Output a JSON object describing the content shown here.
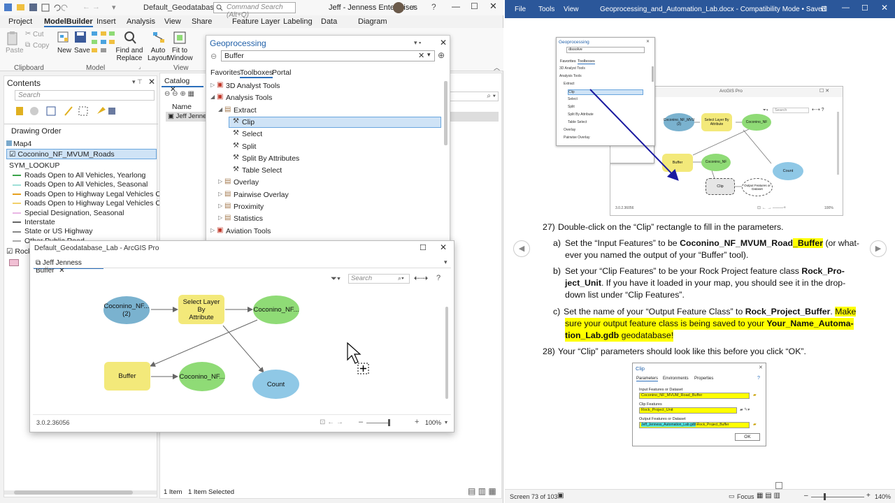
{
  "arcgis": {
    "window_title": "Default_Geodatabase_Lab",
    "command_search_placeholder": "Command Search (Alt+Q)",
    "org": "Jeff - Jenness Enterprises",
    "tabs": [
      "Project",
      "ModelBuilder",
      "Insert",
      "Analysis",
      "View",
      "Share",
      "Feature Layer",
      "Labeling",
      "Data",
      "Diagram"
    ],
    "ribbon": {
      "paste": "Paste",
      "cut": "Cut",
      "copy": "Copy",
      "clipboard_group": "Clipboard",
      "new": "New",
      "save": "Save",
      "model_group": "Model",
      "find_replace": "Find and Replace",
      "auto_layout": "Auto Layout",
      "fit_to_window": "Fit to Window",
      "view_group": "View"
    },
    "contents": {
      "title": "Contents",
      "search_placeholder": "Search",
      "drawing_order": "Drawing Order",
      "map": "Map4",
      "layer": "Coconino_NF_MVUM_Roads",
      "sym_lookup": "SYM_LOOKUP",
      "legend": [
        {
          "label": "Roads Open to All Vehicles, Yearlong",
          "color": "#3aa34a"
        },
        {
          "label": "Roads Open to All Vehicles, Seasonal",
          "color": "#9fe0d8"
        },
        {
          "label": "Roads Open to Highway Legal Vehicles Only, Yearlong",
          "color": "#e6a020"
        },
        {
          "label": "Roads Open to Highway Legal Vehicles Only, Seasonal",
          "color": "#f2d06a"
        },
        {
          "label": "Special Designation, Seasonal",
          "color": "#e9b6e4"
        },
        {
          "label": "Interstate",
          "color": "#666666"
        },
        {
          "label": "State or US Highway",
          "color": "#888888"
        },
        {
          "label": "Other Public Road",
          "color": "#aaaaaa"
        }
      ],
      "rock_layer": "Rock"
    },
    "catalog": {
      "tab": "Catalog",
      "column_name": "Name",
      "item": "Jeff Jennes",
      "status_items": "1 Item",
      "status_selected": "1 Item Selected"
    },
    "geoprocessing": {
      "title": "Geoprocessing",
      "search_value": "Buffer",
      "tabs": [
        "Favorites",
        "Toolboxes",
        "Portal"
      ],
      "tree": [
        {
          "label": "3D Analyst Tools",
          "level": 0,
          "type": "toolbox",
          "expanded": false
        },
        {
          "label": "Analysis Tools",
          "level": 0,
          "type": "toolbox",
          "expanded": true
        },
        {
          "label": "Extract",
          "level": 1,
          "type": "toolset",
          "expanded": true
        },
        {
          "label": "Clip",
          "level": 2,
          "type": "tool",
          "selected": true
        },
        {
          "label": "Select",
          "level": 2,
          "type": "tool"
        },
        {
          "label": "Split",
          "level": 2,
          "type": "tool"
        },
        {
          "label": "Split By Attributes",
          "level": 2,
          "type": "tool"
        },
        {
          "label": "Table Select",
          "level": 2,
          "type": "tool"
        },
        {
          "label": "Overlay",
          "level": 1,
          "type": "toolset",
          "expanded": false
        },
        {
          "label": "Pairwise Overlay",
          "level": 1,
          "type": "toolset",
          "expanded": false
        },
        {
          "label": "Proximity",
          "level": 1,
          "type": "toolset",
          "expanded": false
        },
        {
          "label": "Statistics",
          "level": 1,
          "type": "toolset",
          "expanded": false
        },
        {
          "label": "Aviation Tools",
          "level": 0,
          "type": "toolbox",
          "expanded": false
        }
      ]
    },
    "modelbuilder": {
      "title": "Default_Geodatabase_Lab - ArcGIS Pro",
      "tab": "Jeff Jenness Buffer",
      "search_placeholder": "Search",
      "version": "3.0.2.36056",
      "zoom": "100%",
      "nodes": {
        "input": "Coconino_NF...\n(2)",
        "select": "Select Layer By\nAttribute",
        "output": "Coconino_NF...",
        "buffer": "Buffer",
        "buffer_out": "Coconino_NF...",
        "count": "Count"
      }
    }
  },
  "word": {
    "menu": [
      "File",
      "Tools",
      "View"
    ],
    "title": "Geoprocessing_and_Automation_Lab.docx - Compatibility Mode • Saved",
    "steps": {
      "s27_num": "27)",
      "s27": "Double-click on the “Clip” rectangle to fill in the parameters.",
      "a_lbl": "a)",
      "a_1": "Set the “Input Features” to be ",
      "a_bold": "Coconino_NF_MVUM_Road",
      "a_bold_hl": "_Buffer",
      "a_2": " (or what-",
      "a_3": "ever you named the output of your “Buffer” tool).",
      "b_lbl": "b)",
      "b_1": "Set your “Clip Features” to be your Rock Project feature class ",
      "b_bold": "Rock_Pro-",
      "b_2_bold": "ject_Unit",
      "b_2": ".  If you have it loaded in your map, you should see it in the drop-",
      "b_3": "down list under “Clip Features”.",
      "c_lbl": "c)",
      "c_1": "Set the name of your “Output Feature Class” to ",
      "c_bold": "Rock_Project_Buffer",
      "c_2": ". ",
      "c_hl1": "Make",
      "c_hl2": "sure your output feature class is being saved to your ",
      "c_hl2_bold": "Your_Name_Automa-",
      "c_hl3_bold": "tion_Lab.gdb",
      "c_hl3": " geodatabase!",
      "s28_num": "28)",
      "s28": "Your “Clip” parameters should look like this before you click “OK”."
    },
    "fig1": {
      "gp_title": "Geoprocessing",
      "gp_search": "dissolve",
      "gp_tabs": [
        "Favorites",
        "Toolboxes"
      ],
      "gp_tree": [
        "3D Analyst Tools",
        "Analysis Tools",
        "Extract",
        "Clip",
        "Select",
        "Split",
        "Split By Attribute",
        "Table Select",
        "Overlay",
        "Pairwise Overlay"
      ],
      "window_title": "ArcGIS Pro",
      "search": "Search",
      "nodes": [
        "Coconino_NF_MVU (2)",
        "Select Layer By Attribute",
        "Coconino_NF",
        "Buffer",
        "Coconino_NF",
        "Count",
        "Clip",
        "Output Features or Dataset"
      ],
      "version": "3.0.2.36056",
      "zoom": "100%"
    },
    "fig2": {
      "title": "Clip",
      "tabs": [
        "Parameters",
        "Environments",
        "Properties"
      ],
      "input_label": "Input Features or Dataset",
      "input_value": "Coconino_NF_MVUM_Road_Buffer",
      "clip_label": "Clip Features",
      "clip_value": "Rock_Project_Unit",
      "output_label": "Output Features or Dataset",
      "output_value_hl": "Jeff_Jenness_Automation_Lab.gdb",
      "output_value_rest": "\\Rock_Project_Buffer",
      "ok": "OK"
    },
    "status": {
      "page": "Screen 73 of 103",
      "focus": "Focus",
      "zoom": "140%"
    }
  }
}
